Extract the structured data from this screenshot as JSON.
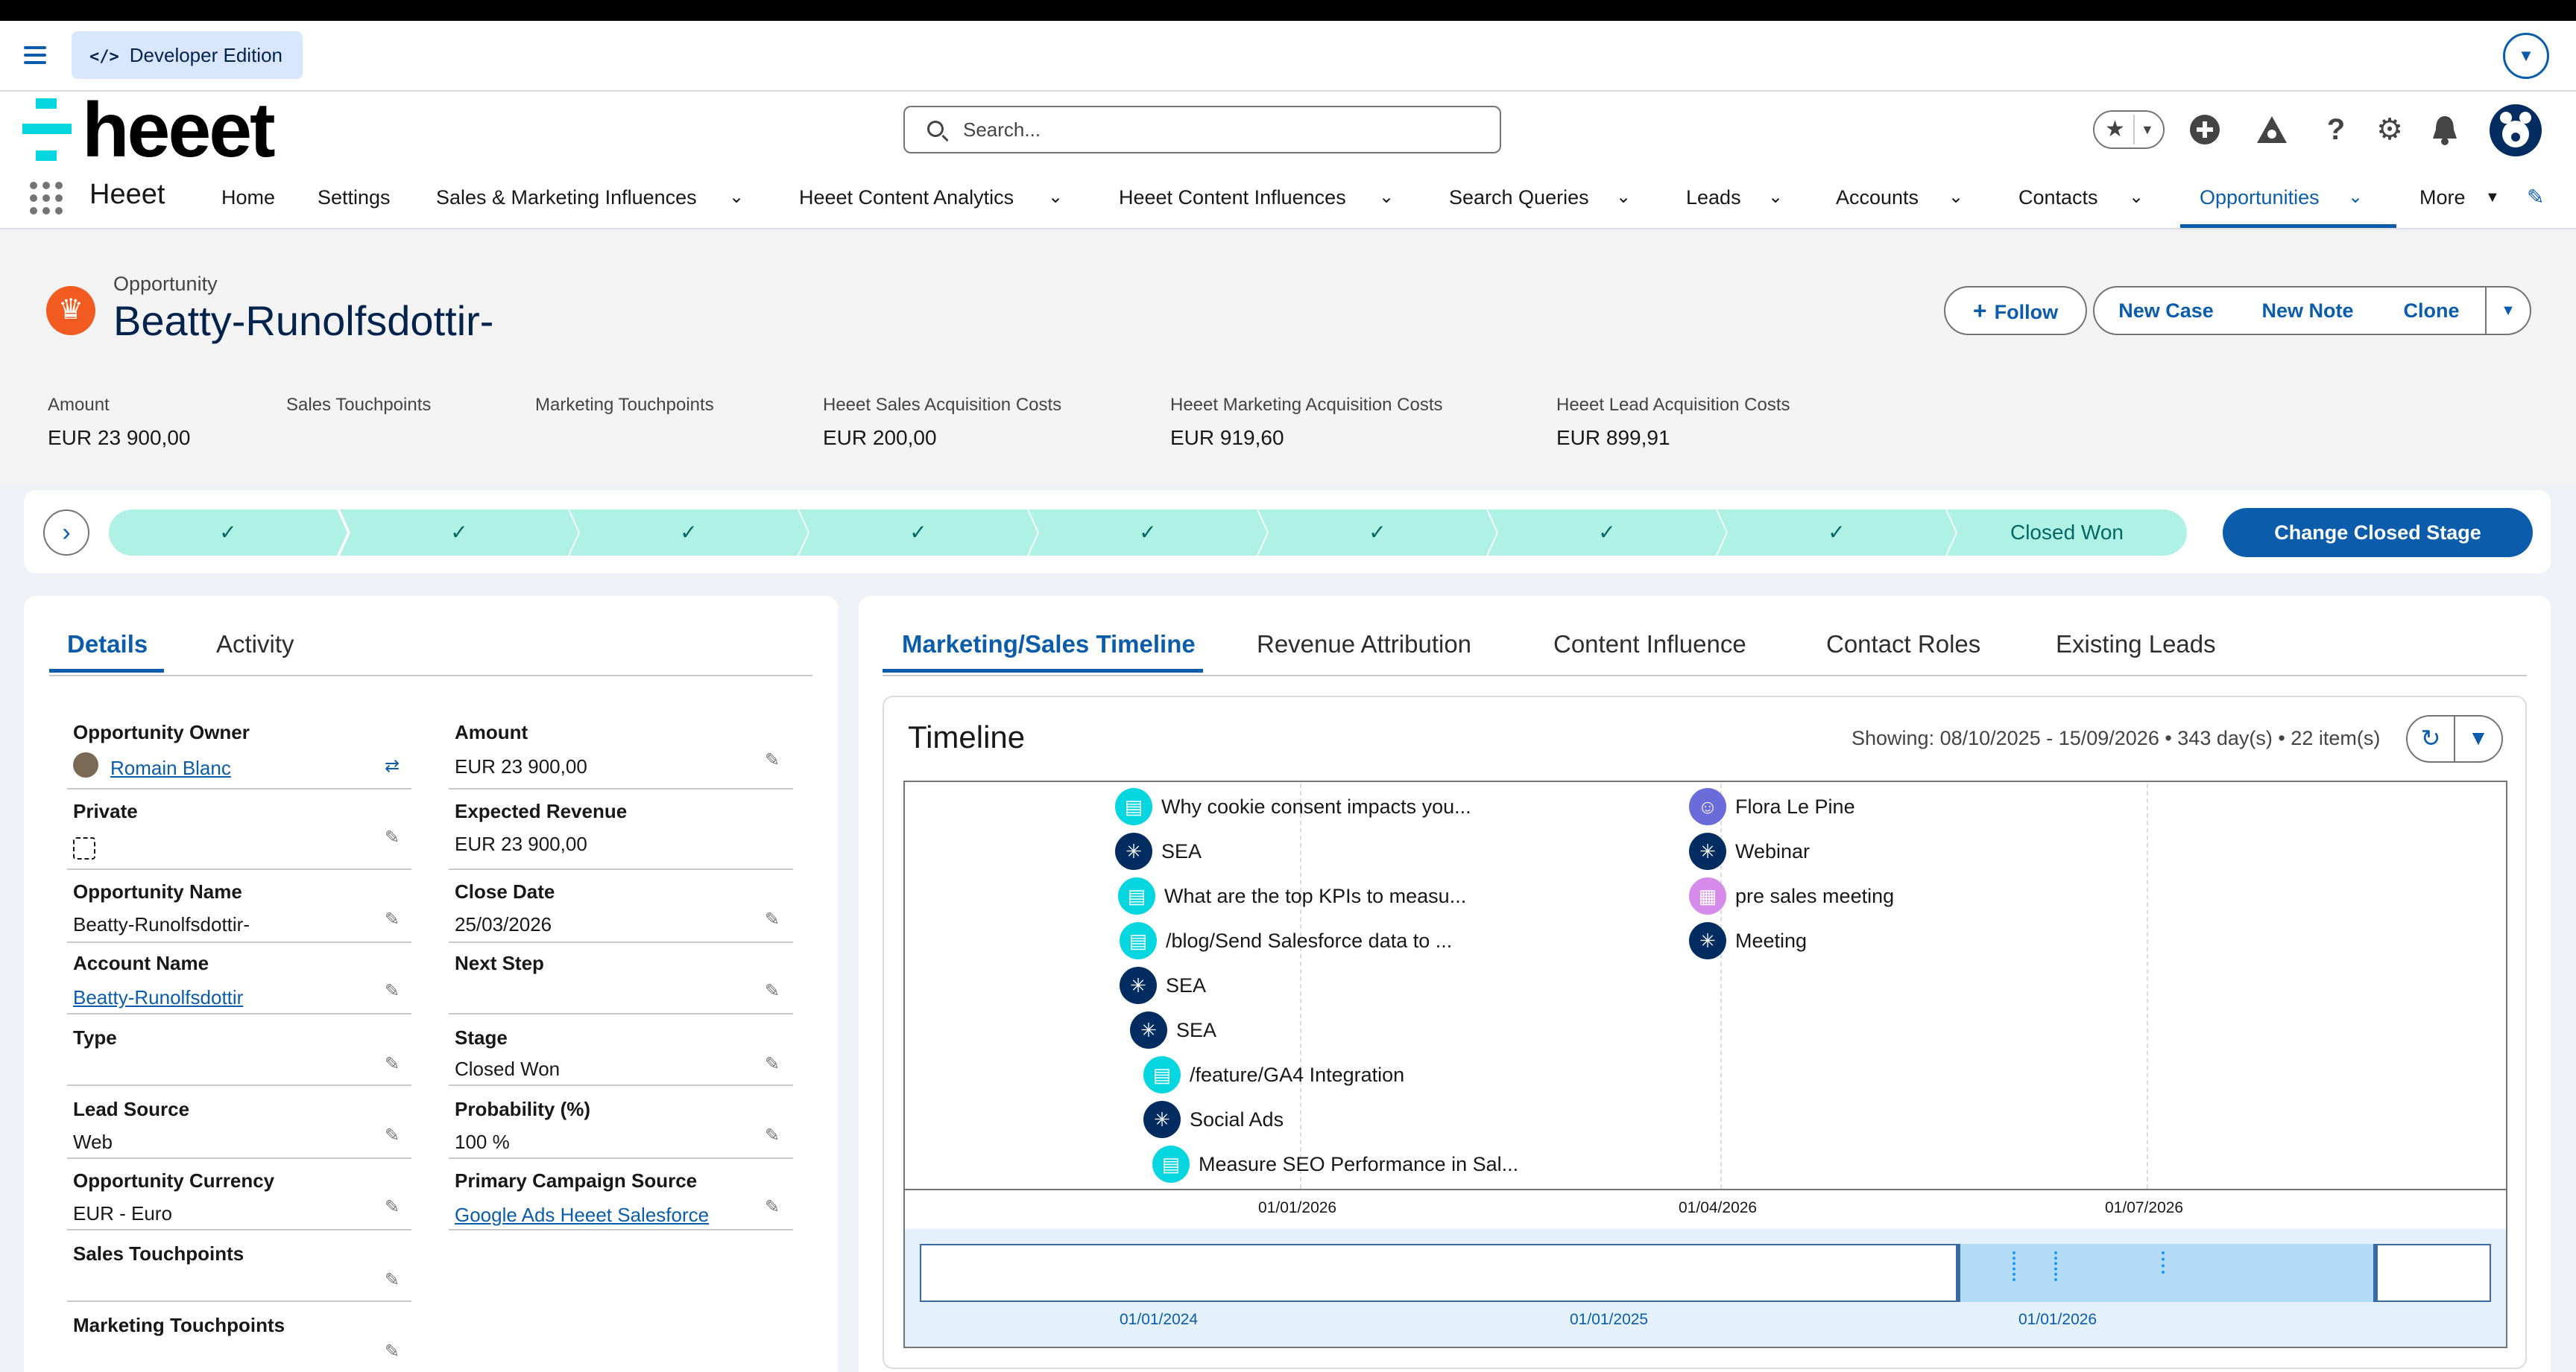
{
  "devbar": {
    "badge_code": "</>",
    "badge_label": "Developer Edition"
  },
  "header": {
    "logo_text": "heeet",
    "search_placeholder": "Search..."
  },
  "nav": {
    "app_name": "Heeet",
    "items": [
      "Home",
      "Settings",
      "Sales & Marketing Influences",
      "Heeet Content Analytics",
      "Heeet Content Influences",
      "Search Queries",
      "Leads",
      "Accounts",
      "Contacts",
      "Opportunities",
      "More"
    ]
  },
  "record": {
    "object_label": "Opportunity",
    "title": "Beatty-Runolfsdottir-",
    "buttons": {
      "follow": "Follow",
      "new_case": "New Case",
      "new_note": "New Note",
      "clone": "Clone"
    },
    "highlights": [
      {
        "label": "Amount",
        "value": "EUR 23 900,00"
      },
      {
        "label": "Sales Touchpoints",
        "value": ""
      },
      {
        "label": "Marketing Touchpoints",
        "value": ""
      },
      {
        "label": "Heeet Sales Acquisition Costs",
        "value": "EUR 200,00"
      },
      {
        "label": "Heeet Marketing Acquisition Costs",
        "value": "EUR 919,60"
      },
      {
        "label": "Heeet Lead Acquisition Costs",
        "value": "EUR 899,91"
      }
    ]
  },
  "path": {
    "current_stage": "Closed Won",
    "action": "Change Closed Stage",
    "completed_steps": 8
  },
  "details": {
    "tabs": [
      "Details",
      "Activity"
    ],
    "left_fields": [
      {
        "label": "Opportunity Owner",
        "value": "Romain Blanc"
      },
      {
        "label": "Private",
        "value": ""
      },
      {
        "label": "Opportunity Name",
        "value": "Beatty-Runolfsdottir-"
      },
      {
        "label": "Account Name",
        "value": "Beatty-Runolfsdottir"
      },
      {
        "label": "Type",
        "value": ""
      },
      {
        "label": "Lead Source",
        "value": "Web"
      },
      {
        "label": "Opportunity Currency",
        "value": "EUR - Euro"
      },
      {
        "label": "Sales Touchpoints",
        "value": ""
      },
      {
        "label": "Marketing Touchpoints",
        "value": ""
      }
    ],
    "right_fields": [
      {
        "label": "Amount",
        "value": "EUR 23 900,00"
      },
      {
        "label": "Expected Revenue",
        "value": "EUR 23 900,00"
      },
      {
        "label": "Close Date",
        "value": "25/03/2026"
      },
      {
        "label": "Next Step",
        "value": ""
      },
      {
        "label": "Stage",
        "value": "Closed Won"
      },
      {
        "label": "Probability (%)",
        "value": "100 %"
      },
      {
        "label": "Primary Campaign Source",
        "value": "Google Ads Heeet Salesforce"
      }
    ]
  },
  "main": {
    "tabs": [
      "Marketing/Sales Timeline",
      "Revenue Attribution",
      "Content Influence",
      "Contact Roles",
      "Existing Leads"
    ],
    "timeline": {
      "title": "Timeline",
      "showing": "Showing: 08/10/2025 - 15/09/2026 • 343 day(s) • 22 item(s)",
      "items_left": [
        {
          "icon": "content-icon",
          "text": "Why cookie consent impacts you..."
        },
        {
          "icon": "channel-icon",
          "text": "SEA"
        },
        {
          "icon": "content-icon",
          "text": "What are the top KPIs to measu..."
        },
        {
          "icon": "content-icon",
          "text": "/blog/Send Salesforce data to ..."
        },
        {
          "icon": "channel-icon",
          "text": "SEA"
        },
        {
          "icon": "channel-icon",
          "text": "SEA"
        },
        {
          "icon": "content-icon",
          "text": "/feature/GA4 Integration"
        },
        {
          "icon": "channel-icon",
          "text": "Social Ads"
        },
        {
          "icon": "content-icon",
          "text": "Measure SEO Performance in Sal..."
        }
      ],
      "items_right": [
        {
          "icon": "contact-icon",
          "text": "Flora Le Pine"
        },
        {
          "icon": "channel-icon",
          "text": "Webinar"
        },
        {
          "icon": "calendar-icon",
          "text": "pre sales meeting"
        },
        {
          "icon": "channel-icon",
          "text": "Meeting"
        }
      ],
      "axis": [
        "01/01/2026",
        "01/04/2026",
        "01/07/2026"
      ],
      "overview_axis": [
        "01/01/2024",
        "01/01/2025",
        "01/01/2026"
      ]
    }
  },
  "colors": {
    "brand": "#0b5cab",
    "path_complete": "#b0f1e6",
    "accent_logo": "#06d6e0"
  }
}
